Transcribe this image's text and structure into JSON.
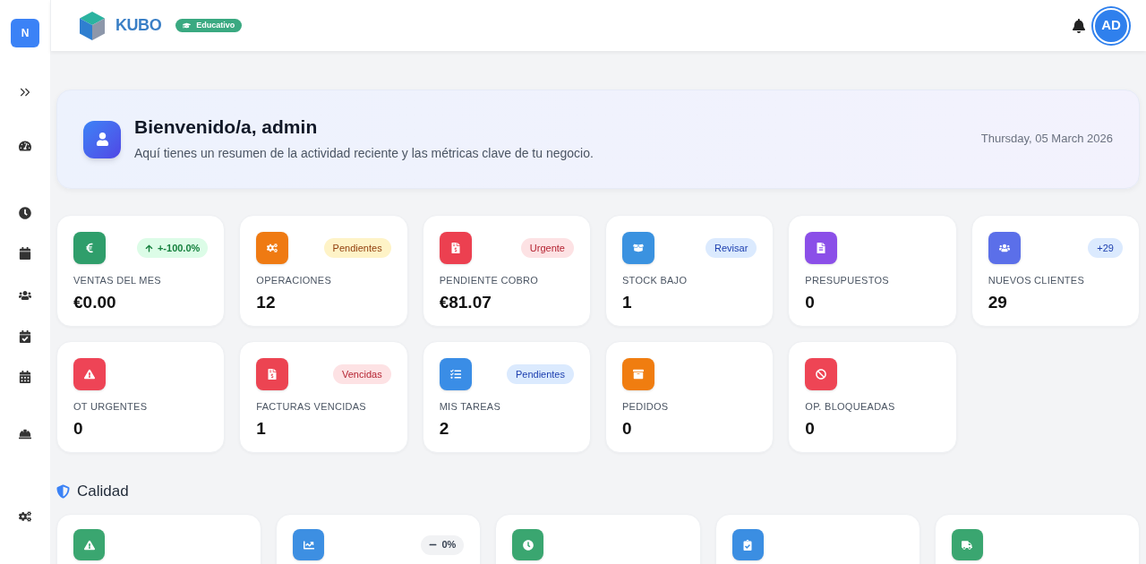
{
  "sidebar": {
    "brand_initial": "N"
  },
  "header": {
    "logo_text": "KUBO",
    "edition_badge": "Educativo",
    "avatar_initials": "AD"
  },
  "welcome": {
    "title": "Bienvenido/a, admin",
    "subtitle": "Aquí tienes un resumen de la actividad reciente y las métricas clave de tu negocio.",
    "date": "Thursday, 05 March 2026"
  },
  "stats": [
    {
      "label": "VENTAS DEL MES",
      "value": "€0.00",
      "color": "#2f9e6b",
      "badge": {
        "text": "+-100.0%",
        "kind": "rising"
      }
    },
    {
      "label": "OPERACIONES",
      "value": "12",
      "color": "#ef7a12",
      "badge": {
        "text": "Pendientes",
        "kind": "warning"
      }
    },
    {
      "label": "PENDIENTE COBRO",
      "value": "€81.07",
      "color": "#ec4050",
      "badge": {
        "text": "Urgente",
        "kind": "danger"
      }
    },
    {
      "label": "STOCK BAJO",
      "value": "1",
      "color": "#3a92e0",
      "badge": {
        "text": "Revisar",
        "kind": "info"
      }
    },
    {
      "label": "PRESUPUESTOS",
      "value": "0",
      "color": "#8b4fe8"
    },
    {
      "label": "NUEVOS CLIENTES",
      "value": "29",
      "color": "#5b6fe9",
      "badge": {
        "text": "+29",
        "kind": "info"
      }
    },
    {
      "label": "OT URGENTES",
      "value": "0",
      "color": "#ee4456"
    },
    {
      "label": "FACTURAS VENCIDAS",
      "value": "1",
      "color": "#ec4452",
      "badge": {
        "text": "Vencidas",
        "kind": "danger"
      }
    },
    {
      "label": "MIS TAREAS",
      "value": "2",
      "color": "#3a8de6",
      "badge": {
        "text": "Pendientes",
        "kind": "info"
      }
    },
    {
      "label": "PEDIDOS",
      "value": "0",
      "color": "#f07d10"
    },
    {
      "label": "OP. BLOQUEADAS",
      "value": "0",
      "color": "#ee4555"
    }
  ],
  "quality": {
    "title": "Calidad",
    "cards": [
      {
        "color": "#3aa670"
      },
      {
        "color": "#3d8fe2",
        "badge": {
          "text": "0%",
          "kind": "flat"
        }
      },
      {
        "color": "#3aa670"
      },
      {
        "color": "#3b8ee2"
      },
      {
        "color": "#3aa670"
      }
    ]
  }
}
